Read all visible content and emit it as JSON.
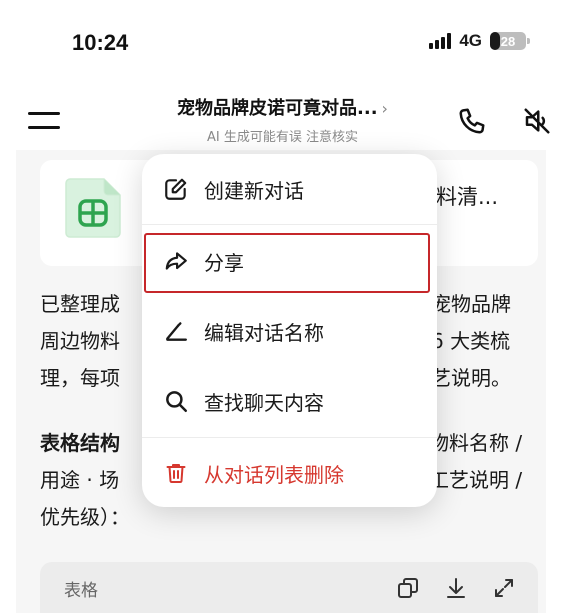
{
  "status_bar": {
    "time": "10:24",
    "network": "4G",
    "battery": "28",
    "battery_level": 0.28
  },
  "header": {
    "title": "宠物品牌皮诺可竟对品...",
    "title_chevron": "›",
    "subtitle": "AI 生成可能有误 注意核实",
    "icons": [
      "menu-icon",
      "phone-icon",
      "speaker-muted-icon"
    ]
  },
  "file_card": {
    "title_visible": "料清...",
    "icon": "spreadsheet-icon",
    "icon_color": "#2ea44f"
  },
  "paragraph1": {
    "lines": [
      {
        "left": "已整理成",
        "right": "宠物品牌"
      },
      {
        "left": "周边物料",
        "right": "6 大类梳"
      },
      {
        "left": "理，每项",
        "right": "艺说明。"
      }
    ]
  },
  "paragraph2": {
    "lines": [
      {
        "left": "表格结构",
        "right": "物料名称 /"
      },
      {
        "left": "用途 · 场",
        "right": "工艺说明 /"
      },
      {
        "left": "优先级）：",
        "right": ""
      }
    ]
  },
  "table_toolbar": {
    "label": "表格",
    "icons": [
      "copy-icon",
      "download-icon",
      "expand-icon"
    ]
  },
  "menu": {
    "items": [
      {
        "label": "创建新对话",
        "icon": "new-chat-icon"
      },
      {
        "label": "分享",
        "icon": "share-icon"
      },
      {
        "label": "编辑对话名称",
        "icon": "edit-icon"
      },
      {
        "label": "查找聊天内容",
        "icon": "search-icon"
      },
      {
        "label": "从对话列表删除",
        "icon": "trash-icon",
        "danger": true
      }
    ],
    "danger_color": "#d6382f",
    "highlight_color": "#c6272a"
  }
}
